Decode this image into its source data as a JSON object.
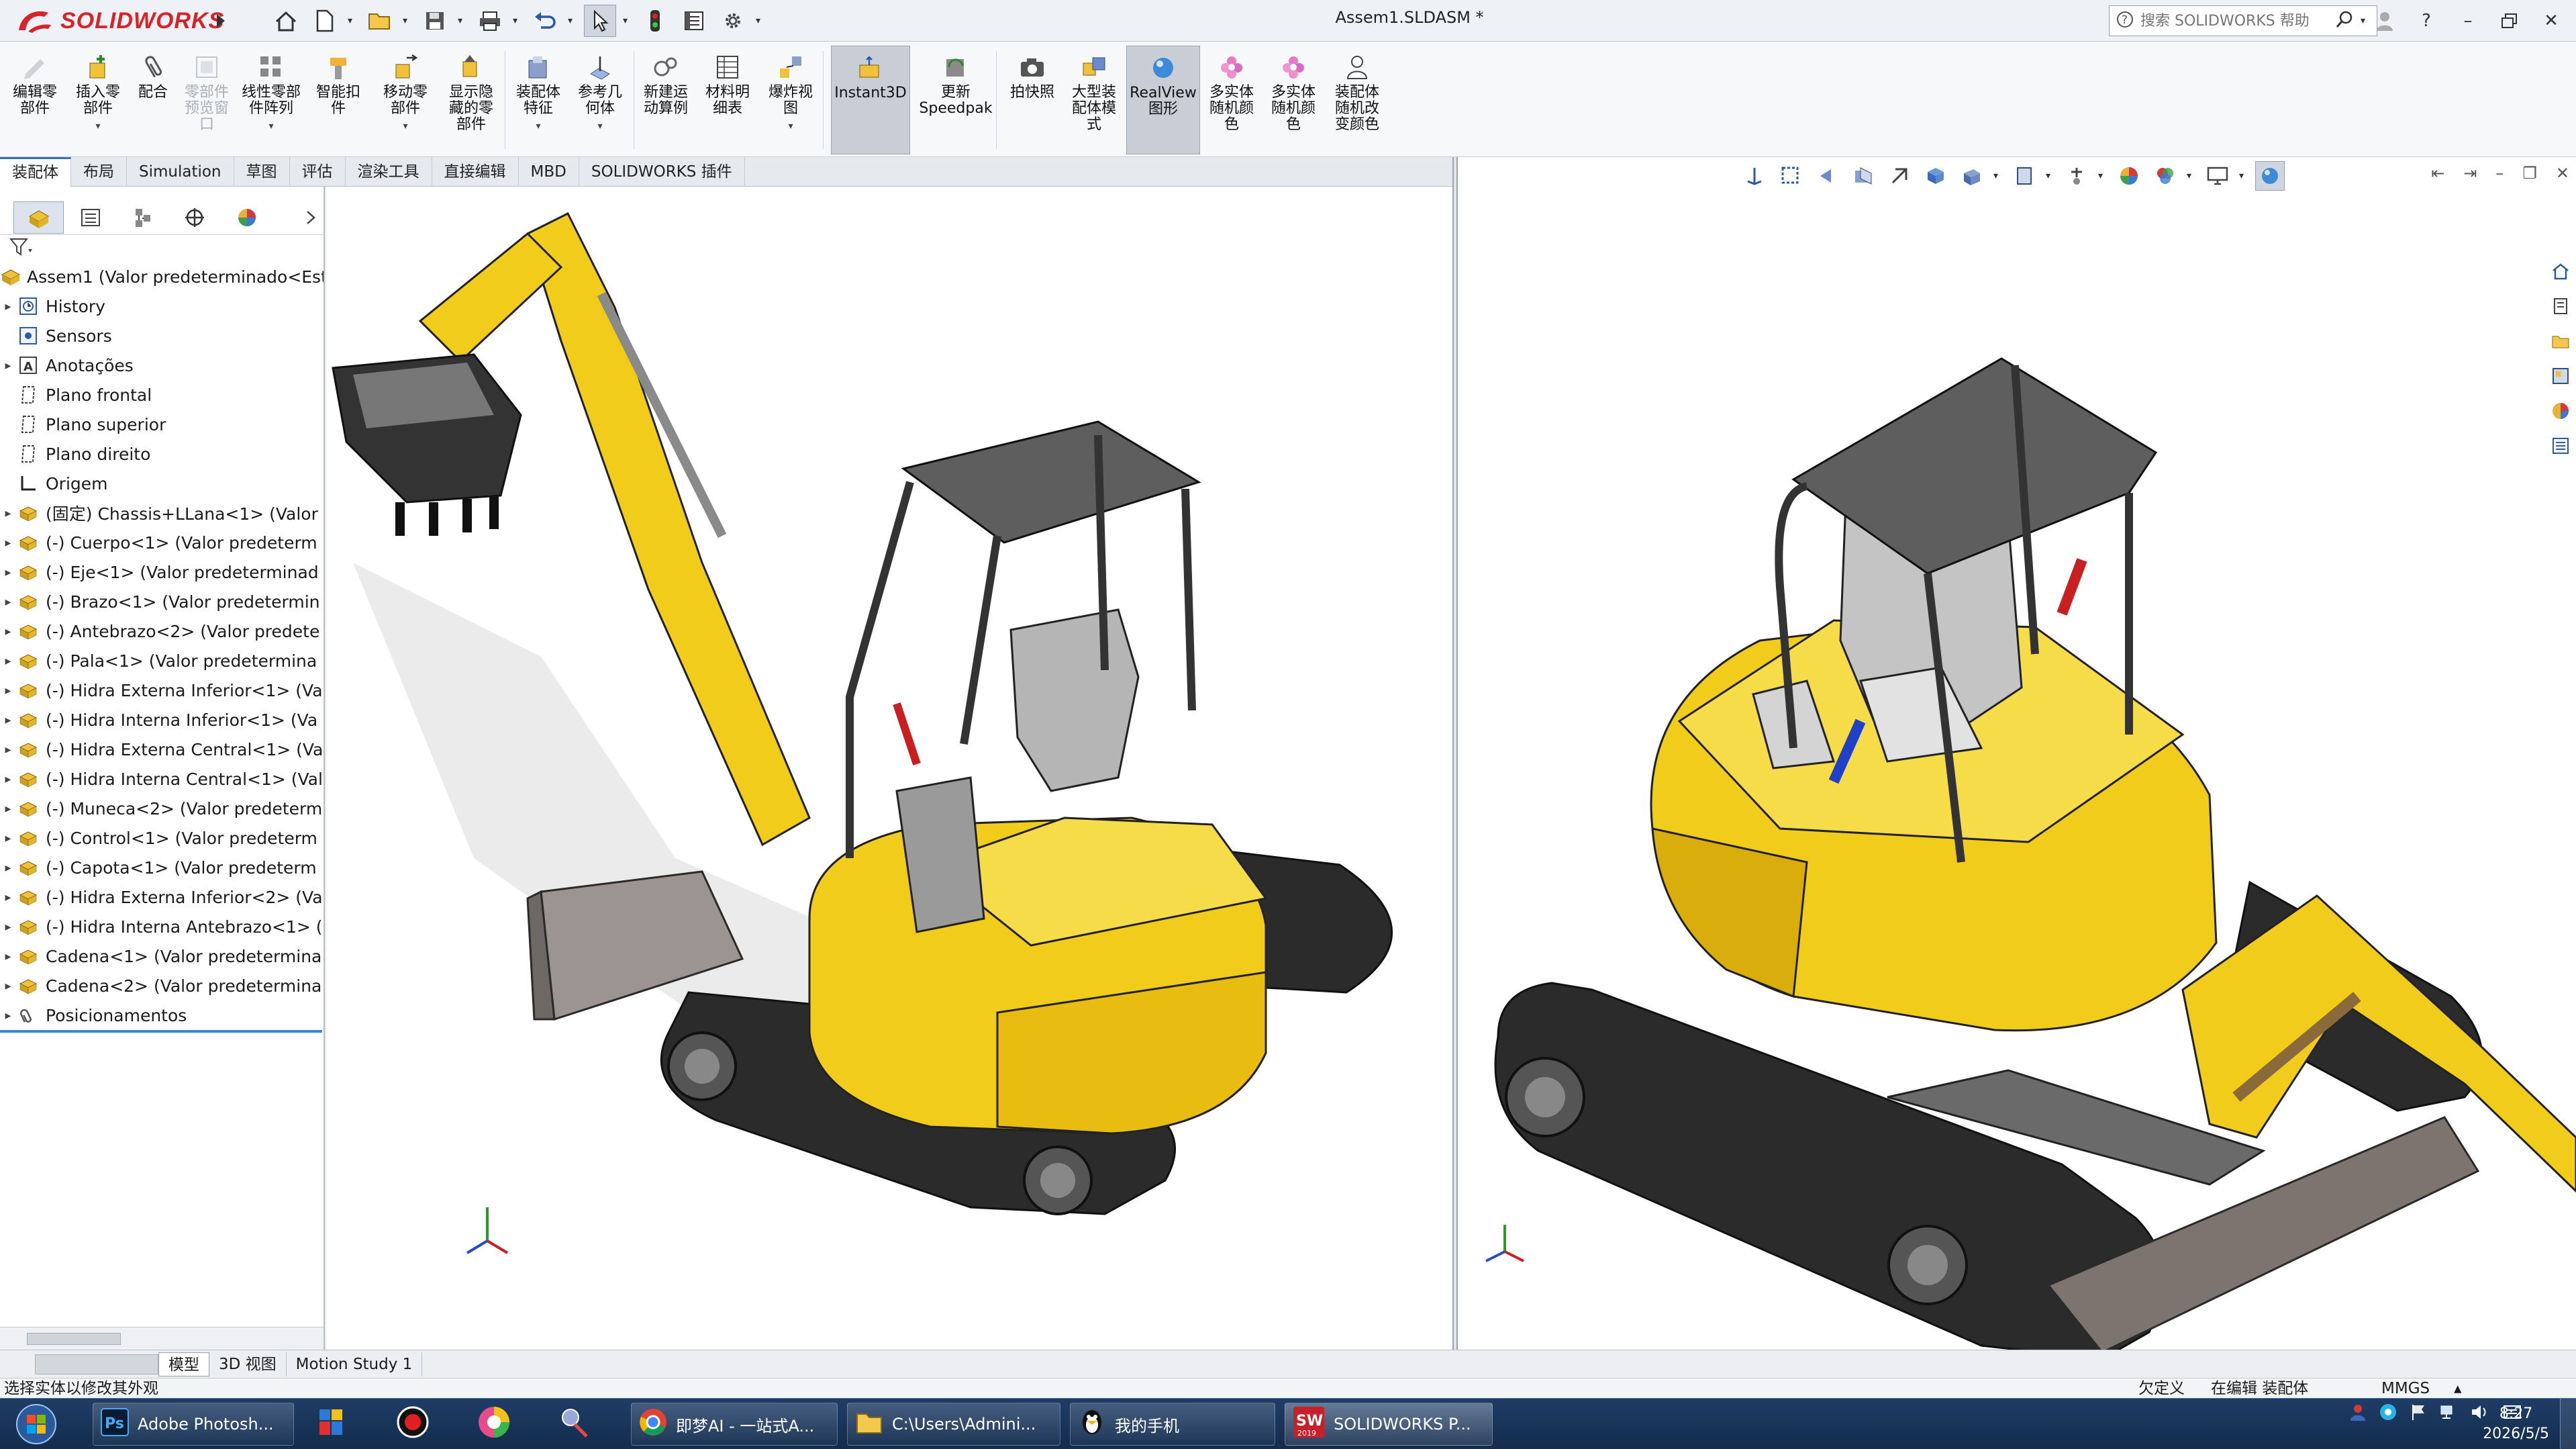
{
  "app": {
    "logo": "SOLIDWORKS",
    "doc_title": "Assem1.SLDASM *",
    "help_search_placeholder": "搜索 SOLIDWORKS 帮助"
  },
  "commands": [
    {
      "label": "编辑零\n部件",
      "state": "disabled"
    },
    {
      "label": "插入零\n部件",
      "state": "normal"
    },
    {
      "label": "配合",
      "state": "normal"
    },
    {
      "label": "零部件\n预览窗\n口",
      "state": "disabled"
    },
    {
      "label": "线性零部\n件阵列",
      "state": "normal"
    },
    {
      "label": "智能扣\n件",
      "state": "normal"
    },
    {
      "label": "移动零\n部件",
      "state": "normal"
    },
    {
      "label": "显示隐\n藏的零\n部件",
      "state": "normal"
    },
    {
      "label": "装配体\n特征",
      "state": "normal"
    },
    {
      "label": "参考几\n何体",
      "state": "normal"
    },
    {
      "label": "新建运\n动算例",
      "state": "normal"
    },
    {
      "label": "材料明\n细表",
      "state": "normal"
    },
    {
      "label": "爆炸视\n图",
      "state": "normal"
    },
    {
      "label": "Instant3D",
      "state": "active"
    },
    {
      "label": "更新\nSpeedpak",
      "state": "normal"
    },
    {
      "label": "拍快照",
      "state": "normal"
    },
    {
      "label": "大型装\n配体模\n式",
      "state": "normal"
    },
    {
      "label": "RealView\n图形",
      "state": "active"
    },
    {
      "label": "多实体\n随机颜\n色",
      "state": "normal"
    },
    {
      "label": "多实体\n随机颜\n色",
      "state": "normal"
    },
    {
      "label": "装配体\n随机改\n变颜色",
      "state": "normal"
    }
  ],
  "cm_tabs": [
    "装配体",
    "布局",
    "Simulation",
    "草图",
    "评估",
    "渲染工具",
    "直接编辑",
    "MBD",
    "SOLIDWORKS 插件"
  ],
  "tree": {
    "root": "Assem1  (Valor predeterminado<Est",
    "nodes": [
      {
        "label": "History",
        "icon": "history-icon",
        "expand": true
      },
      {
        "label": "Sensors",
        "icon": "sensor-icon",
        "expand": false
      },
      {
        "label": "Anotações",
        "icon": "annotation-icon",
        "expand": true
      },
      {
        "label": "Plano frontal",
        "icon": "plane-icon",
        "expand": false
      },
      {
        "label": "Plano superior",
        "icon": "plane-icon",
        "expand": false
      },
      {
        "label": "Plano direito",
        "icon": "plane-icon",
        "expand": false
      },
      {
        "label": "Origem",
        "icon": "origin-icon",
        "expand": false
      },
      {
        "label": "(固定) Chassis+LLana<1> (Valor",
        "icon": "part-icon",
        "expand": true
      },
      {
        "label": "(-) Cuerpo<1> (Valor predeterm",
        "icon": "part-icon",
        "expand": true
      },
      {
        "label": "(-) Eje<1> (Valor predeterminad",
        "icon": "part-icon",
        "expand": true
      },
      {
        "label": "(-) Brazo<1> (Valor predetermin",
        "icon": "part-icon",
        "expand": true
      },
      {
        "label": "(-) Antebrazo<2> (Valor predete",
        "icon": "part-icon",
        "expand": true
      },
      {
        "label": "(-) Pala<1> (Valor predetermina",
        "icon": "part-icon",
        "expand": true
      },
      {
        "label": "(-) Hidra Externa Inferior<1> (Va",
        "icon": "part-icon",
        "expand": true
      },
      {
        "label": "(-) Hidra Interna Inferior<1> (Va",
        "icon": "part-icon",
        "expand": true
      },
      {
        "label": "(-) Hidra Externa Central<1> (Va",
        "icon": "part-icon",
        "expand": true
      },
      {
        "label": "(-) Hidra Interna Central<1> (Val",
        "icon": "part-icon",
        "expand": true
      },
      {
        "label": "(-) Muneca<2> (Valor predeterm",
        "icon": "part-icon",
        "expand": true
      },
      {
        "label": "(-) Control<1> (Valor predeterm",
        "icon": "part-icon",
        "expand": true
      },
      {
        "label": "(-) Capota<1> (Valor predeterm",
        "icon": "part-icon",
        "expand": true
      },
      {
        "label": "(-) Hidra Externa Inferior<2> (Va",
        "icon": "part-icon",
        "expand": true
      },
      {
        "label": "(-) Hidra Interna Antebrazo<1> (",
        "icon": "part-icon",
        "expand": true
      },
      {
        "label": "Cadena<1> (Valor predetermina",
        "icon": "part-icon",
        "expand": true
      },
      {
        "label": "Cadena<2> (Valor predetermina",
        "icon": "part-icon",
        "expand": true
      },
      {
        "label": "Posicionamentos",
        "icon": "mates-icon",
        "expand": true
      }
    ]
  },
  "bottom_tabs": [
    "模型",
    "3D 视图",
    "Motion Study 1"
  ],
  "status": {
    "message": "选择实体以修改其外观",
    "state": "欠定义",
    "mode": "在编辑 装配体",
    "units": "MMGS"
  },
  "taskbar": {
    "items": [
      "Adobe Photosh...",
      "即梦AI - 一站式A...",
      "C:\\Users\\Admini...",
      "我的手机",
      "SOLIDWORKS P..."
    ],
    "time": "8:27",
    "date": "2026/5/5"
  },
  "colors": {
    "machine_yellow": "#f2cc1a",
    "track_dark": "#2b2b2b",
    "brand_red": "#d6242a"
  }
}
